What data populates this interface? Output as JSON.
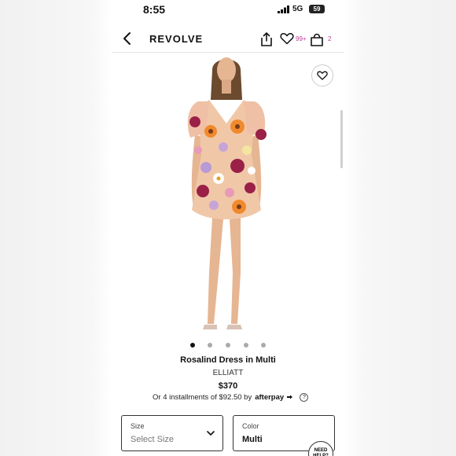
{
  "status_bar": {
    "time": "8:55",
    "network": "5G",
    "battery": "59"
  },
  "header": {
    "brand": "REVOLVE",
    "wishlist_count": "99+",
    "bag_count": "2"
  },
  "gallery": {
    "dot_count": 5,
    "active_dot": 0
  },
  "product": {
    "name": "Rosalind Dress in Multi",
    "designer": "ELLIATT",
    "price": "$370",
    "installments": "Or 4 installments of $92.50 by",
    "afterpay": "afterpay",
    "help_icon_text": "?"
  },
  "size_select": {
    "label": "Size",
    "value": "Select Size"
  },
  "color_select": {
    "label": "Color",
    "value": "Multi"
  },
  "help_button": {
    "label": "NEED HELP?"
  },
  "colors": {
    "accent": "#c23b9b",
    "dress_base": "#f0c8a8",
    "skin": "#e6b592"
  }
}
